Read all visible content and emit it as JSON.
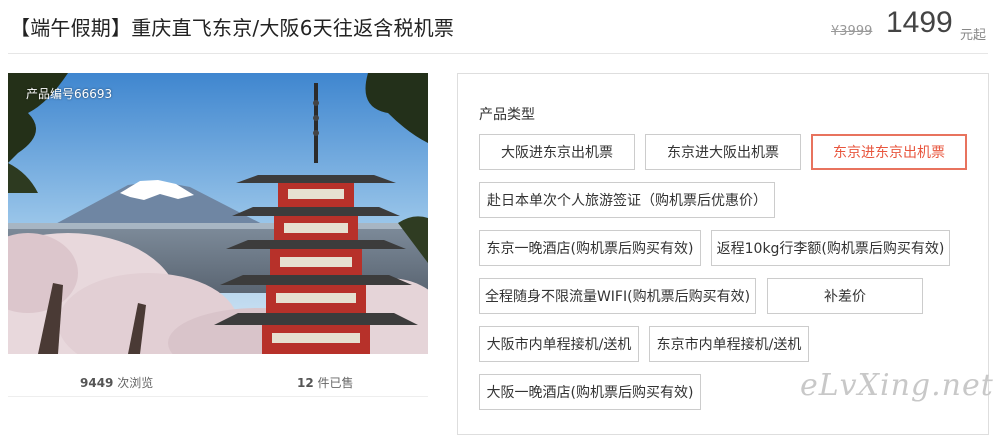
{
  "header": {
    "title": "【端午假期】重庆直飞东京/大阪6天往返含税机票",
    "original_price": "¥3999",
    "price": "1499",
    "price_unit": "元起"
  },
  "gallery": {
    "product_no": "产品编号66693",
    "image_alt": "Pagoda with Mount Fuji and cherry blossoms"
  },
  "stats": {
    "views_count": "9449",
    "views_label": "次浏览",
    "sold_count": "12",
    "sold_label": "件已售"
  },
  "options": {
    "label": "产品类型",
    "items": [
      "大阪进东京出机票",
      "东京进大阪出机票",
      "东京进东京出机票",
      "赴日本单次个人旅游签证（购机票后优惠价）",
      "东京一晚酒店(购机票后购买有效)",
      "返程10kg行李额(购机票后购买有效)",
      "全程随身不限流量WIFI(购机票后购买有效)",
      "补差价",
      "大阪市内单程接机/送机",
      "东京市内单程接机/送机",
      "大阪一晚酒店(购机票后购买有效)"
    ],
    "selected_index": 2
  },
  "watermark": "eLvXing.net",
  "colors": {
    "accent": "#e8735e",
    "selected_text": "#e8563e",
    "border": "#cccccc"
  }
}
